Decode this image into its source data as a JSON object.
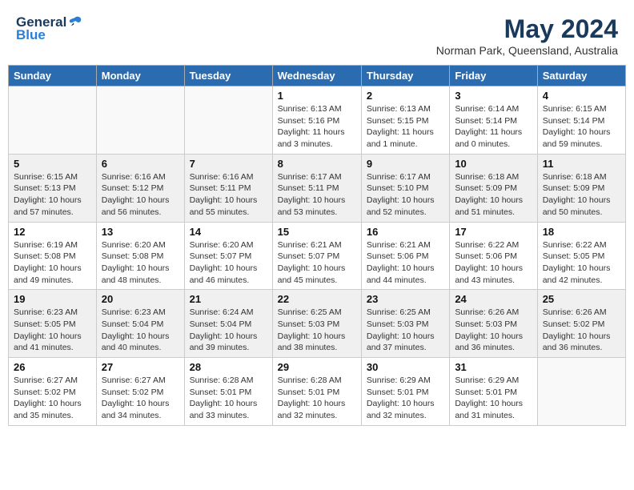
{
  "header": {
    "logo_general": "General",
    "logo_blue": "Blue",
    "month_title": "May 2024",
    "location": "Norman Park, Queensland, Australia"
  },
  "days_of_week": [
    "Sunday",
    "Monday",
    "Tuesday",
    "Wednesday",
    "Thursday",
    "Friday",
    "Saturday"
  ],
  "weeks": [
    [
      {
        "day": "",
        "info": ""
      },
      {
        "day": "",
        "info": ""
      },
      {
        "day": "",
        "info": ""
      },
      {
        "day": "1",
        "info": "Sunrise: 6:13 AM\nSunset: 5:16 PM\nDaylight: 11 hours and 3 minutes."
      },
      {
        "day": "2",
        "info": "Sunrise: 6:13 AM\nSunset: 5:15 PM\nDaylight: 11 hours and 1 minute."
      },
      {
        "day": "3",
        "info": "Sunrise: 6:14 AM\nSunset: 5:14 PM\nDaylight: 11 hours and 0 minutes."
      },
      {
        "day": "4",
        "info": "Sunrise: 6:15 AM\nSunset: 5:14 PM\nDaylight: 10 hours and 59 minutes."
      }
    ],
    [
      {
        "day": "5",
        "info": "Sunrise: 6:15 AM\nSunset: 5:13 PM\nDaylight: 10 hours and 57 minutes."
      },
      {
        "day": "6",
        "info": "Sunrise: 6:16 AM\nSunset: 5:12 PM\nDaylight: 10 hours and 56 minutes."
      },
      {
        "day": "7",
        "info": "Sunrise: 6:16 AM\nSunset: 5:11 PM\nDaylight: 10 hours and 55 minutes."
      },
      {
        "day": "8",
        "info": "Sunrise: 6:17 AM\nSunset: 5:11 PM\nDaylight: 10 hours and 53 minutes."
      },
      {
        "day": "9",
        "info": "Sunrise: 6:17 AM\nSunset: 5:10 PM\nDaylight: 10 hours and 52 minutes."
      },
      {
        "day": "10",
        "info": "Sunrise: 6:18 AM\nSunset: 5:09 PM\nDaylight: 10 hours and 51 minutes."
      },
      {
        "day": "11",
        "info": "Sunrise: 6:18 AM\nSunset: 5:09 PM\nDaylight: 10 hours and 50 minutes."
      }
    ],
    [
      {
        "day": "12",
        "info": "Sunrise: 6:19 AM\nSunset: 5:08 PM\nDaylight: 10 hours and 49 minutes."
      },
      {
        "day": "13",
        "info": "Sunrise: 6:20 AM\nSunset: 5:08 PM\nDaylight: 10 hours and 48 minutes."
      },
      {
        "day": "14",
        "info": "Sunrise: 6:20 AM\nSunset: 5:07 PM\nDaylight: 10 hours and 46 minutes."
      },
      {
        "day": "15",
        "info": "Sunrise: 6:21 AM\nSunset: 5:07 PM\nDaylight: 10 hours and 45 minutes."
      },
      {
        "day": "16",
        "info": "Sunrise: 6:21 AM\nSunset: 5:06 PM\nDaylight: 10 hours and 44 minutes."
      },
      {
        "day": "17",
        "info": "Sunrise: 6:22 AM\nSunset: 5:06 PM\nDaylight: 10 hours and 43 minutes."
      },
      {
        "day": "18",
        "info": "Sunrise: 6:22 AM\nSunset: 5:05 PM\nDaylight: 10 hours and 42 minutes."
      }
    ],
    [
      {
        "day": "19",
        "info": "Sunrise: 6:23 AM\nSunset: 5:05 PM\nDaylight: 10 hours and 41 minutes."
      },
      {
        "day": "20",
        "info": "Sunrise: 6:23 AM\nSunset: 5:04 PM\nDaylight: 10 hours and 40 minutes."
      },
      {
        "day": "21",
        "info": "Sunrise: 6:24 AM\nSunset: 5:04 PM\nDaylight: 10 hours and 39 minutes."
      },
      {
        "day": "22",
        "info": "Sunrise: 6:25 AM\nSunset: 5:03 PM\nDaylight: 10 hours and 38 minutes."
      },
      {
        "day": "23",
        "info": "Sunrise: 6:25 AM\nSunset: 5:03 PM\nDaylight: 10 hours and 37 minutes."
      },
      {
        "day": "24",
        "info": "Sunrise: 6:26 AM\nSunset: 5:03 PM\nDaylight: 10 hours and 36 minutes."
      },
      {
        "day": "25",
        "info": "Sunrise: 6:26 AM\nSunset: 5:02 PM\nDaylight: 10 hours and 36 minutes."
      }
    ],
    [
      {
        "day": "26",
        "info": "Sunrise: 6:27 AM\nSunset: 5:02 PM\nDaylight: 10 hours and 35 minutes."
      },
      {
        "day": "27",
        "info": "Sunrise: 6:27 AM\nSunset: 5:02 PM\nDaylight: 10 hours and 34 minutes."
      },
      {
        "day": "28",
        "info": "Sunrise: 6:28 AM\nSunset: 5:01 PM\nDaylight: 10 hours and 33 minutes."
      },
      {
        "day": "29",
        "info": "Sunrise: 6:28 AM\nSunset: 5:01 PM\nDaylight: 10 hours and 32 minutes."
      },
      {
        "day": "30",
        "info": "Sunrise: 6:29 AM\nSunset: 5:01 PM\nDaylight: 10 hours and 32 minutes."
      },
      {
        "day": "31",
        "info": "Sunrise: 6:29 AM\nSunset: 5:01 PM\nDaylight: 10 hours and 31 minutes."
      },
      {
        "day": "",
        "info": ""
      }
    ]
  ]
}
